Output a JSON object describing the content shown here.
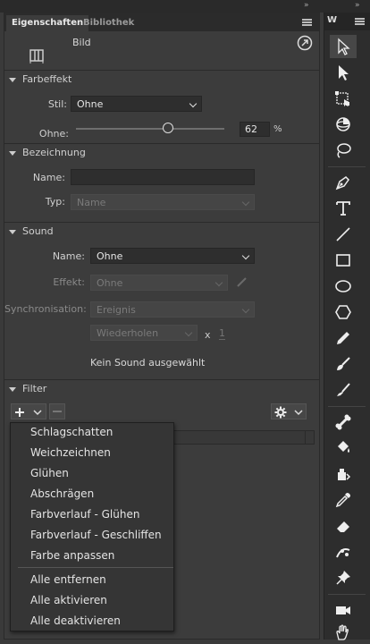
{
  "tabs": {
    "properties": "Eigenschaften",
    "library": "Bibliothek"
  },
  "header": {
    "type_label": "Bild"
  },
  "color_effect": {
    "title": "Farbeffekt",
    "style_label": "Stil:",
    "style_value": "Ohne",
    "amount_label": "Ohne:",
    "amount_value": "62",
    "amount_unit": "%",
    "slider_fraction": 0.62
  },
  "naming": {
    "title": "Bezeichnung",
    "name_label": "Name:",
    "name_value": "",
    "type_label": "Typ:",
    "type_value": "Name"
  },
  "sound": {
    "title": "Sound",
    "name_label": "Name:",
    "name_value": "Ohne",
    "effect_label": "Effekt:",
    "effect_value": "Ohne",
    "sync_label": "Synchronisation:",
    "sync_value": "Ereignis",
    "repeat_value": "Wiederholen",
    "times_symbol": "x",
    "repeat_count": "1",
    "status": "Kein Sound ausgewählt"
  },
  "filter": {
    "title": "Filter",
    "menu_items": [
      "Schlagschatten",
      "Weichzeichnen",
      "Glühen",
      "Abschrägen",
      "Farbverlauf - Glühen",
      "Farbverlauf - Geschliffen",
      "Farbe anpassen"
    ],
    "menu_actions": [
      "Alle entfernen",
      "Alle aktivieren",
      "Alle deaktivieren"
    ]
  },
  "tools_panel": {
    "header_letter": "W"
  },
  "colors": {
    "panel_bg": "#3c3c3c",
    "toolbar_bg": "#2d2d2d",
    "field_bg": "#2e2e2e",
    "selected_tool_bg": "#474747"
  }
}
